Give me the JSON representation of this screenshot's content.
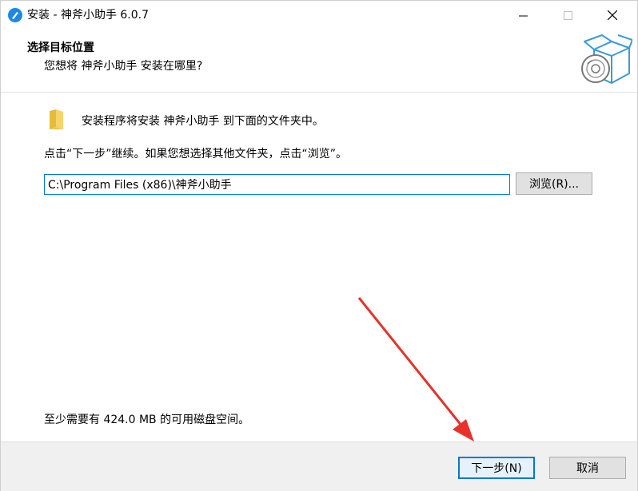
{
  "window": {
    "title": "安装 - 神斧小助手 6.0.7",
    "controls": {
      "minimize": "minimize-icon",
      "maximize": "maximize-icon",
      "close": "close-icon"
    }
  },
  "header": {
    "title": "选择目标位置",
    "subtitle": "您想将 神斧小助手 安装在哪里?",
    "art_icon": "installer-box-disc-icon"
  },
  "body": {
    "folder_icon": "folder-icon",
    "info_text": "安装程序将安装 神斧小助手 到下面的文件夹中。",
    "instruction": "点击“下一步”继续。如果您想选择其他文件夹，点击“浏览”。",
    "path_value": "C:\\Program Files (x86)\\神斧小助手",
    "browse_label": "浏览(R)...",
    "space_required": "至少需要有 424.0 MB 的可用磁盘空间。"
  },
  "footer": {
    "next_label": "下一步(N)",
    "cancel_label": "取消"
  },
  "annotation": {
    "arrow_color": "#e8312a",
    "arrow_target": "next-button"
  },
  "colors": {
    "accent": "#0078d7",
    "footer_bg": "#f0f0f0",
    "button_bg": "#e1e1e1",
    "folder": "#f8d26a"
  }
}
